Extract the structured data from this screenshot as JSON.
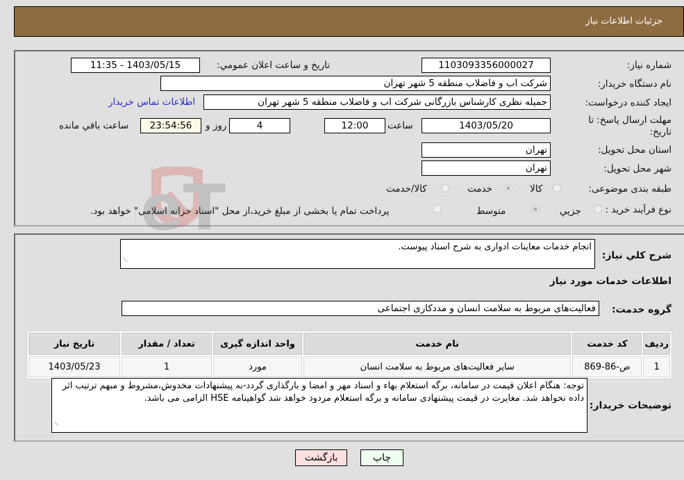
{
  "header": {
    "title": "جزئیات اطلاعات نیاز"
  },
  "form": {
    "need_number": {
      "label": "شماره نیاز:",
      "value": "1103093356000027"
    },
    "announce_datetime": {
      "label": "تاریخ و ساعت اعلان عمومي:",
      "value": "1403/05/15 - 11:35"
    },
    "buyer_org": {
      "label": "نام دستگاه خریدار:",
      "value": "شرکت اب و فاضلاب منطقه 5 شهر تهران"
    },
    "requester": {
      "label": "ایجاد کننده درخواست:",
      "value": "جمیله نظری کارشناس بازرگانی شرکت اب و فاضلاب منطقه 5 شهر تهران"
    },
    "buyer_contact_link": "اطلاعات تماس خریدار",
    "deadline": {
      "label": "مهلت ارسال پاسخ: تا تاریخ:",
      "date": "1403/05/20",
      "time_label": "ساعت",
      "time": "12:00",
      "days": "4",
      "days_label": "روز و",
      "remaining": "23:54:56",
      "remaining_label": "ساعت باقي مانده"
    },
    "province": {
      "label": "استان محل تحویل:",
      "value": "تهران"
    },
    "city": {
      "label": "شهر محل تحویل:",
      "value": "تهران"
    },
    "category": {
      "label": "طبقه بندی موضوعی:",
      "options": [
        "کالا",
        "خدمت",
        "کالا/خدمت"
      ],
      "selected": "خدمت"
    },
    "purchase_type": {
      "label": "نوع فرآیند خرید :",
      "options": [
        "جزيي",
        "متوسط"
      ],
      "selected": "متوسط",
      "treasury_note": "پرداخت تمام یا بخشی از مبلغ خرید،از محل \"اسناد خزانه اسلامی\" خواهد بود."
    }
  },
  "details": {
    "summary_label": "شرح کلي نياز:",
    "summary_value": "انجام خدمات معاینات ادواری به شرح اسناد پیوست.",
    "services_heading": "اطلاعات خدمات مورد نیاز",
    "service_group_label": "گروه خدمت:",
    "service_group_value": "فعالیت‌های مربوط به سلامت انسان و مددکاری اجتماعی",
    "table": {
      "headers": [
        "ردیف",
        "کد خدمت",
        "نام خدمت",
        "واحد اندازه گیری",
        "تعداد / مقدار",
        "تاریخ نیاز"
      ],
      "rows": [
        [
          "1",
          "ص-86-869",
          "سایر فعالیت‌های مربوط به سلامت انسان",
          "مورد",
          "1",
          "1403/05/23"
        ]
      ]
    },
    "buyer_notes_label": "توضیحات خریدار:",
    "buyer_notes_value": "توجه: هنگام اعلان قیمت در سامانه، برگه استعلام بهاء و اسناد مهر و امضا و بارگذاری گردد-به پیشنهادات مخدوش،مشروط و مبهم ترتیب اثر داده نخواهد شد. مغایرت در قیمت پیشنهادی سامانه و برگه استعلام مردود خواهد شد گواهینامه HSE الزامی می باشد."
  },
  "buttons": {
    "print": "چاپ",
    "back": "بازگشت"
  },
  "colors": {
    "header_bg": "#8e6c41",
    "print_bg": "#efffef",
    "back_bg": "#ffe0e0",
    "link": "#2a2ad0"
  }
}
